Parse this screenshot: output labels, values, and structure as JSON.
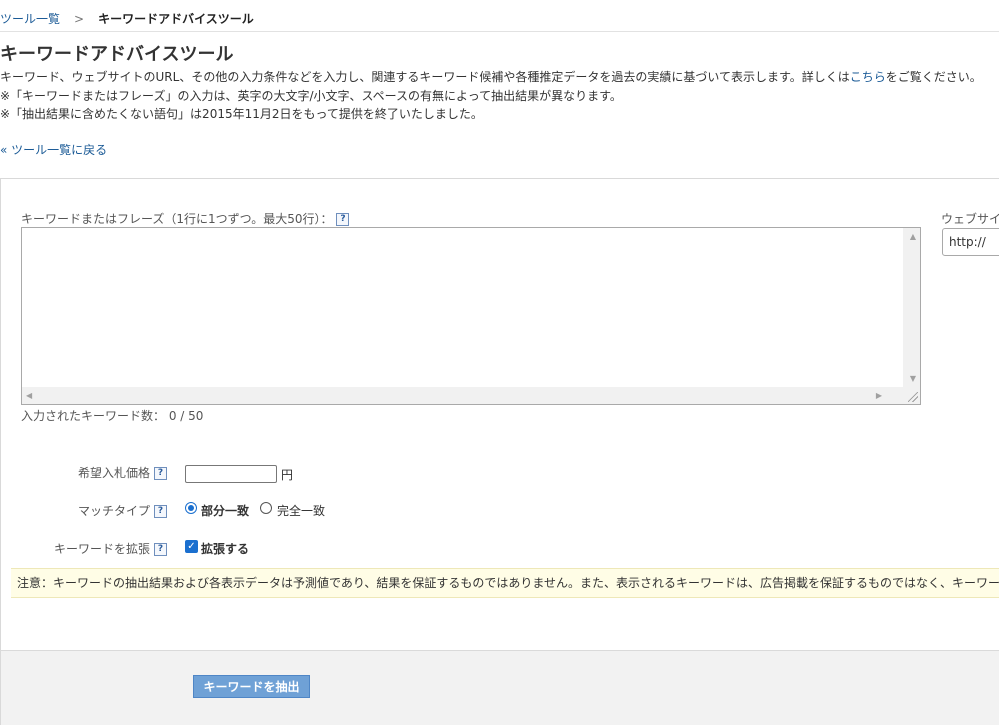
{
  "breadcrumb": {
    "tools_link": "ツール一覧",
    "separator": ">",
    "current": "キーワードアドバイスツール"
  },
  "page": {
    "title": "キーワードアドバイスツール"
  },
  "description": {
    "line1_before": "キーワード、ウェブサイトのURL、その他の入力条件などを入力し、関連するキーワード候補や各種推定データを過去の実績に基づいて表示します。詳しくは",
    "line1_link": "こちら",
    "line1_after": "をご覧ください。",
    "line2": "※「キーワードまたはフレーズ」の入力は、英字の大文字/小文字、スペースの有無によって抽出結果が異なります。",
    "line3": "※「抽出結果に含めたくない語句」は2015年11月2日をもって提供を終了いたしました。"
  },
  "back_link": "« ツール一覧に戻る",
  "form": {
    "keyword_label": "キーワードまたはフレーズ（1行に1つずつ。最大50行）：",
    "website_label": "ウェブサイト",
    "url_value": "http://",
    "keyword_count_label": "入力されたキーワード数：",
    "keyword_count": "0 / 50",
    "help_glyph": "?",
    "bid_label": "希望入札価格",
    "bid_unit": "円",
    "bid_value": "",
    "match_label": "マッチタイプ",
    "match_partial": "部分一致",
    "match_exact": "完全一致",
    "match_selected": "部分一致",
    "expand_label": "キーワードを拡張",
    "expand_option": "拡張する",
    "expand_checked": true,
    "check_glyph": "✓"
  },
  "notice": "注意：キーワードの抽出結果および各表示データは予測値であり、結果を保証するものではありません。また、表示されるキーワードは、広告掲載を保証するものではなく、キーワー",
  "submit_label": "キーワードを抽出",
  "colors": {
    "link": "#1a5a96",
    "accent": "#1a6fcf",
    "button": "#6fa1d6",
    "notice_bg": "#fffde6",
    "footer_bg": "#f2f2f2"
  },
  "scroll_arrows": {
    "up": "▲",
    "down": "▼",
    "left": "◀",
    "right": "▶"
  }
}
